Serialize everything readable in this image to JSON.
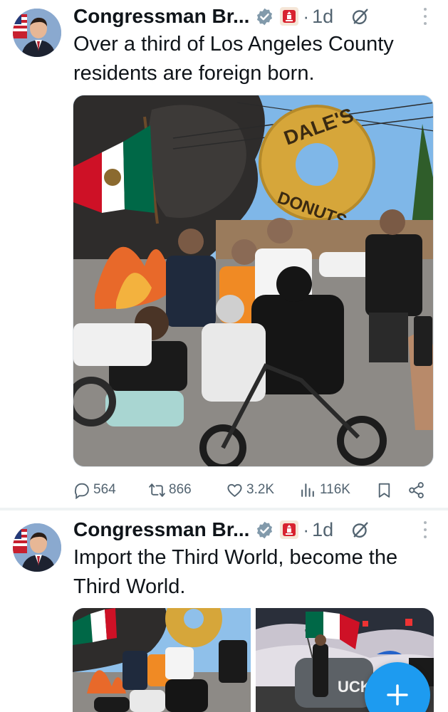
{
  "tweets": [
    {
      "author": "Congressman Br...",
      "separator": "·",
      "time": "1d",
      "text": "Over a third of Los Angeles County residents are foreign born.",
      "media": {
        "type": "single-photo",
        "sign_text": "DALE'S DONUTS",
        "description_icons": [
          "mexican-flag",
          "fire",
          "smoke",
          "donut-sign",
          "crowd",
          "minibike"
        ]
      },
      "stats": {
        "replies": "564",
        "reposts": "866",
        "likes": "3.2K",
        "views": "116K"
      }
    },
    {
      "author": "Congressman Br...",
      "separator": "·",
      "time": "1d",
      "text": "Import the Third World, become the Third World.",
      "media": {
        "type": "photo-grid",
        "right_photo_text": "UCK"
      }
    }
  ],
  "fab": {
    "icon": "plus-icon",
    "label": "+"
  },
  "colors": {
    "brand_blue": "#1d9bf0",
    "muted": "#536471",
    "text": "#0f1419",
    "badge_red": "#c8202f"
  }
}
